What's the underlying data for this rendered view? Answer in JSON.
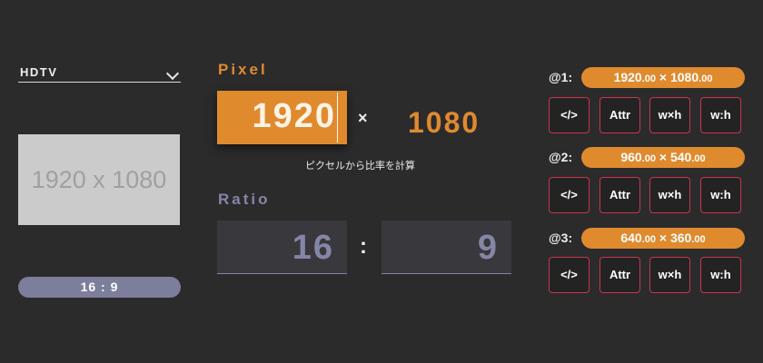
{
  "preset": {
    "label": "HDTV"
  },
  "preview": {
    "text": "1920 x 1080"
  },
  "ratio_badge": "16 : 9",
  "pixel": {
    "title": "Pixel",
    "width": "1920",
    "times": "×",
    "height": "1080",
    "hint": "ピクセルから比率を計算"
  },
  "ratio": {
    "title": "Ratio",
    "left": "16",
    "colon": ":",
    "right": "9"
  },
  "scales": [
    {
      "label": "@1:",
      "w": "1920",
      "h": "1080",
      "dec": ".00",
      "x": "×"
    },
    {
      "label": "@2:",
      "w": "960",
      "h": "540",
      "dec": ".00",
      "x": "×"
    },
    {
      "label": "@3:",
      "w": "640",
      "h": "360",
      "dec": ".00",
      "x": "×"
    }
  ],
  "buttons": {
    "code": "</>",
    "attr": "Attr",
    "wxh": "w×h",
    "wh": "w:h"
  },
  "colors": {
    "accent": "#e08a2e",
    "muted": "#8585a6",
    "button_border": "#c8374b",
    "background": "#2b2b2c"
  }
}
